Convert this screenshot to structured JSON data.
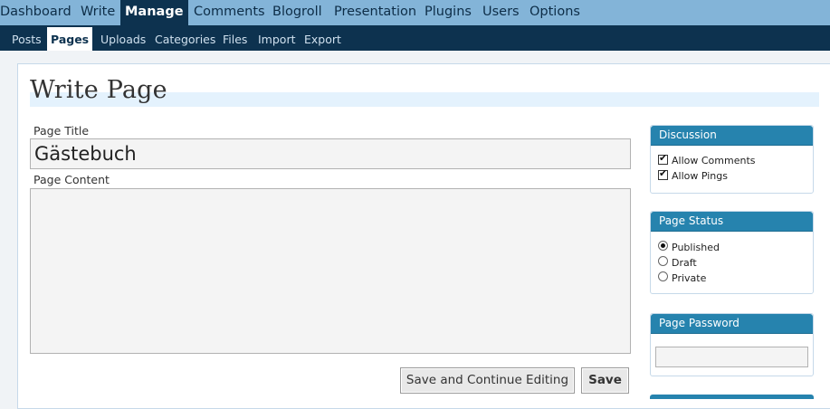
{
  "top_nav": [
    "Dashboard",
    "Write",
    "Manage",
    "Comments",
    "Blogroll",
    "Presentation",
    "Plugins",
    "Users",
    "Options"
  ],
  "top_nav_active": "Manage",
  "sub_nav": [
    "Posts",
    "Pages",
    "Uploads",
    "Categories",
    "Files",
    "Import",
    "Export"
  ],
  "sub_nav_active": "Pages",
  "page_heading": "Write Page",
  "form": {
    "title_label": "Page Title",
    "title_value": "Gästebuch",
    "content_label": "Page Content",
    "content_value": ""
  },
  "buttons": {
    "save_continue": "Save and Continue Editing",
    "save": "Save"
  },
  "sidebar": {
    "discussion": {
      "title": "Discussion",
      "allow_comments": "Allow Comments",
      "allow_comments_checked": true,
      "allow_pings": "Allow Pings",
      "allow_pings_checked": true
    },
    "status": {
      "title": "Page Status",
      "options": [
        "Published",
        "Draft",
        "Private"
      ],
      "selected": "Published"
    },
    "password": {
      "title": "Page Password",
      "value": ""
    }
  },
  "colors": {
    "top_nav_bg": "#83b4d8",
    "sub_nav_bg": "#0d324f",
    "panel_header": "#2683ae",
    "title_band": "#e4f2fd"
  }
}
